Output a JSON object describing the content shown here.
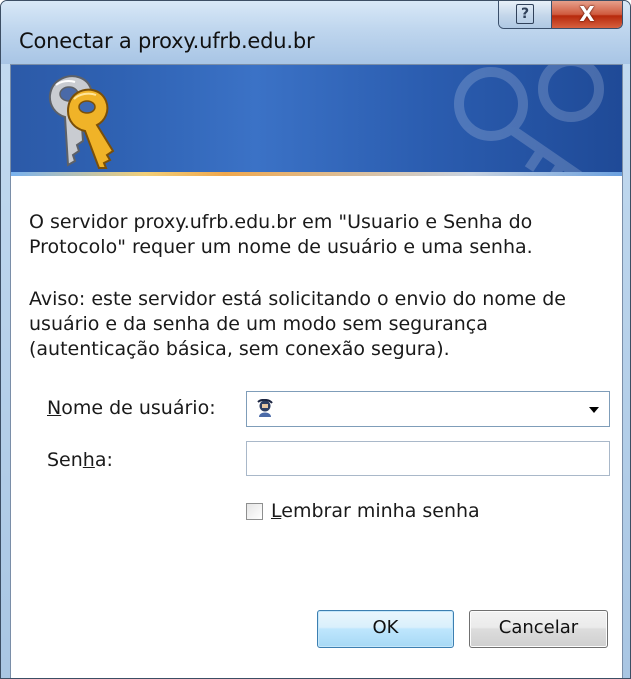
{
  "window": {
    "title": "Conectar a proxy.ufrb.edu.br",
    "help_glyph": "?",
    "close_glyph": "X"
  },
  "message": {
    "paragraph1": "O servidor proxy.ufrb.edu.br em \"Usuario e Senha do Protocolo\" requer um nome de usuário e uma senha.",
    "paragraph2": "Aviso: este servidor está solicitando o envio do nome de usuário e da senha de um modo sem segurança (autenticação básica, sem conexão segura)."
  },
  "form": {
    "username_label_prefix": "N",
    "username_label_rest": "ome de usuário:",
    "username_value": "",
    "password_label_prefix": "Sen",
    "password_label_key": "h",
    "password_label_rest": "a:",
    "password_value": "",
    "remember_key": "L",
    "remember_rest": "embrar minha senha",
    "remember_checked": false
  },
  "buttons": {
    "ok": "OK",
    "cancel": "Cancelar"
  },
  "icons": {
    "banner": "keys-icon",
    "user": "user-icon",
    "dropdown": "chevron-down-icon"
  }
}
